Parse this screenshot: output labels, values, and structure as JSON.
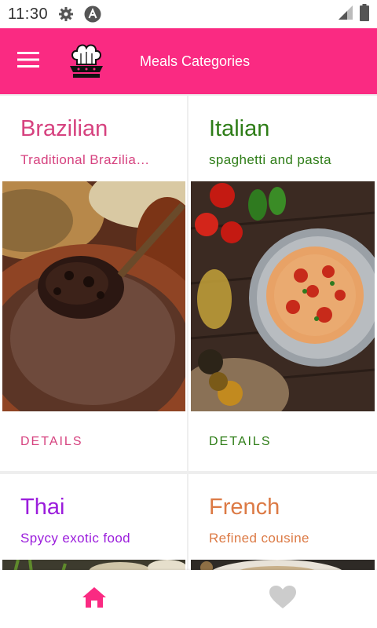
{
  "status_bar": {
    "time": "11:30",
    "icons": [
      "settings-icon",
      "app-notification-icon",
      "signal-icon",
      "battery-icon"
    ]
  },
  "app_bar": {
    "title": "Meals Categories",
    "menu_icon": "hamburger-menu-icon",
    "logo_icon": "chef-logo-icon",
    "color": "#fa2a82"
  },
  "categories": [
    {
      "title": "Brazilian",
      "subtitle": "Traditional Brazilia…",
      "details_label": "DETAILS",
      "color": "#d6427f",
      "image": "feijoada-dish"
    },
    {
      "title": "Italian",
      "subtitle": "spaghetti and pasta",
      "details_label": "DETAILS",
      "color": "#2e7d17",
      "image": "spaghetti-plate"
    },
    {
      "title": "Thai",
      "subtitle": "Spycy exotic food",
      "details_label": "",
      "color": "#9b1ddc",
      "image": "thai-dish"
    },
    {
      "title": "French",
      "subtitle": "Refined cousine",
      "details_label": "",
      "color": "#dc7a45",
      "image": "french-dish"
    }
  ],
  "bottom_nav": {
    "items": [
      {
        "icon": "home-icon",
        "active": true,
        "color": "#fa2a82"
      },
      {
        "icon": "heart-icon",
        "active": false,
        "color": "#cccccc"
      }
    ]
  }
}
